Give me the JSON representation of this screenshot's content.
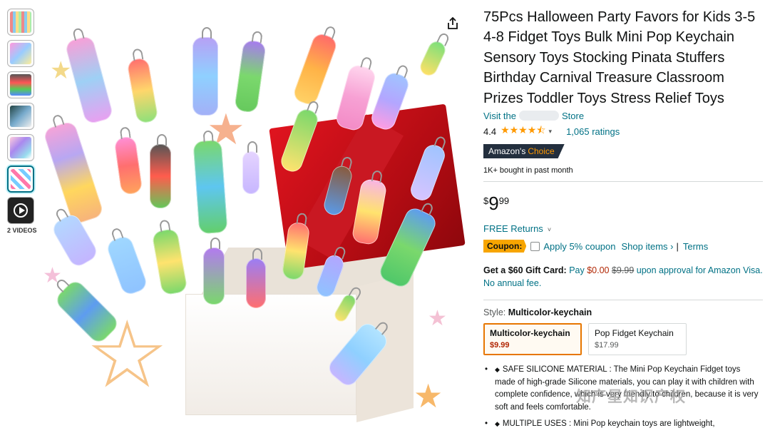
{
  "gallery": {
    "thumbnails": [
      "thumbnail-1",
      "thumbnail-2",
      "thumbnail-3",
      "thumbnail-4",
      "thumbnail-5",
      "thumbnail-6"
    ],
    "videos_label": "2 VIDEOS"
  },
  "product": {
    "title": "75Pcs Halloween Party Favors for Kids 3-5 4-8 Fidget Toys Bulk Mini Pop Keychain Sensory Toys Stocking Pinata Stuffers Birthday Carnival Treasure Classroom Prizes Toddler Toys Stress Relief Toys",
    "store_prefix": "Visit the",
    "store_suffix": "Store",
    "rating": "4.4",
    "stars": "★★★★⯪",
    "ratings_count": "1,065 ratings",
    "badge_prefix": "Amazon's",
    "badge_choice": "Choice",
    "bought": "1K+ bought in past month",
    "price": {
      "currency": "$",
      "whole": "9",
      "fraction": "99"
    },
    "free_returns": "FREE Returns",
    "coupon": {
      "tag": "Coupon:",
      "apply": "Apply 5% coupon",
      "shop": "Shop items ›",
      "sep": "|",
      "terms": "Terms"
    },
    "gift_card": {
      "bold": "Get a $60 Gift Card:",
      "pay": "Pay",
      "amount": "$0.00",
      "original": "$9.99",
      "rest": "upon approval for Amazon Visa. No annual fee."
    },
    "style": {
      "label": "Style:",
      "selected": "Multicolor-keychain",
      "options": [
        {
          "name": "Multicolor-keychain",
          "price": "$9.99"
        },
        {
          "name": "Pop Fidget Keychain",
          "price": "$17.99"
        }
      ]
    },
    "bullets": [
      "SAFE SILICONE MATERIAL : The Mini Pop Keychain Fidget toys made of high-grade Silicone materials, you can play it with children with complete confidence, which is very friendly to children, because it is very soft and feels comfortable.",
      "MULTIPLE USES : Mini Pop keychain toys are lightweight,"
    ]
  },
  "watermark": "知产星知识产权",
  "colors": {
    "link": "#007185",
    "price_red": "#b12704",
    "star": "#ff9900",
    "badge_bg": "#232f3e",
    "coupon": "#f7a500",
    "selected_border": "#e77600"
  }
}
